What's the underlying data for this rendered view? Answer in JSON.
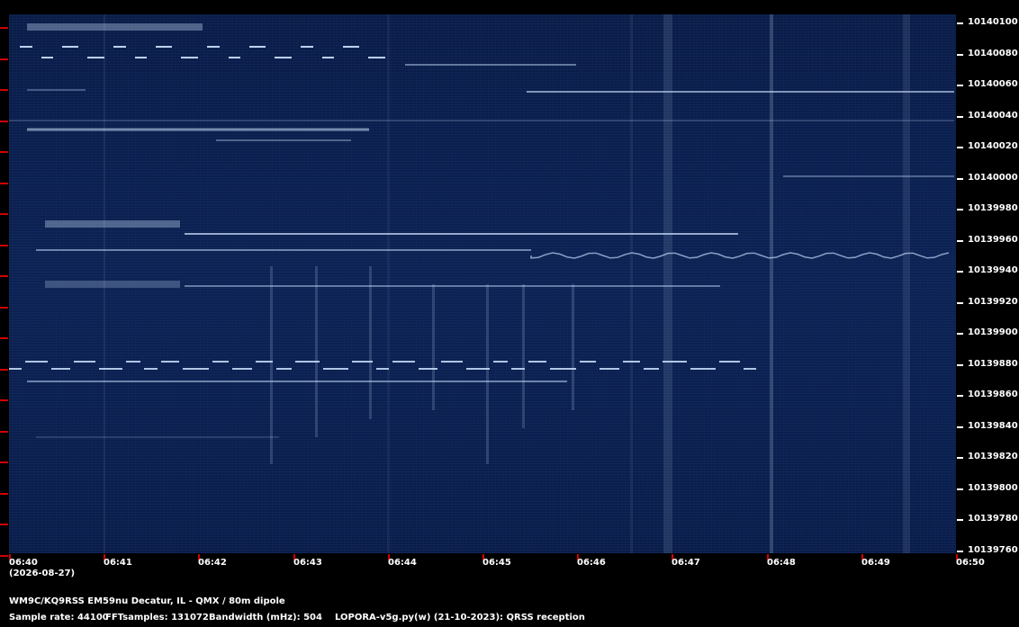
{
  "spectrogram": {
    "y_labels": [
      "10140100",
      "10140080",
      "10140060",
      "10140040",
      "10140020",
      "10140000",
      "10139980",
      "10139960",
      "10139940",
      "10139920",
      "10139900",
      "10139880",
      "10139860",
      "10139840",
      "10139820",
      "10139800",
      "10139780",
      "10139760"
    ],
    "x_labels": [
      "06:40",
      "06:41",
      "06:42",
      "06:43",
      "06:44",
      "06:45",
      "06:46",
      "06:47",
      "06:48",
      "06:49",
      "06:50"
    ],
    "date": "(2026-08-27)"
  },
  "footer": {
    "station": "WM9C/KQ9RSS EM59nu Decatur, IL - QMX / 80m dipole",
    "sample_rate": "Sample rate: 44100",
    "fft_samples": "FFTsamples: 131072",
    "bandwidth": "Bandwidth (mHz): 504",
    "software": "LOPORA-v5g.py(w) (21-10-2023): QRSS reception"
  },
  "colors": {
    "background": "#000000",
    "waterfall": "#0b1f4a",
    "signal": "#cfe4ff",
    "tick": "#d00000"
  }
}
